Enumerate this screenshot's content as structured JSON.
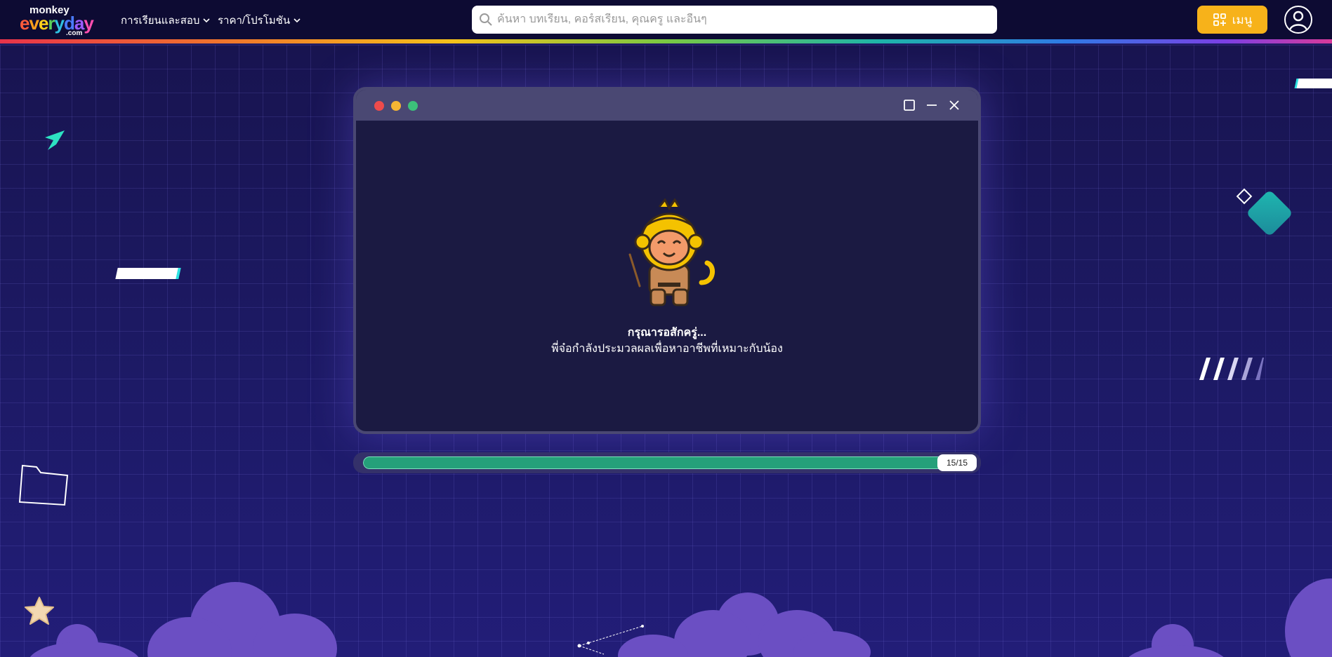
{
  "header": {
    "logo": {
      "top": "monkey",
      "main": "everyday",
      "suffix": ".com"
    },
    "nav": [
      {
        "label": "การเรียนและสอบ"
      },
      {
        "label": "ราคา/โปรโมชัน"
      }
    ],
    "search_placeholder": "ค้นหา บทเรียน, คอร์สเรียน, คุณครู และอื่นๆ",
    "menu_label": "เมนู"
  },
  "loading": {
    "title": "กรุณารอสักครู่...",
    "subtitle": "พี่จ๋อกำลังประมวลผลเพื่อหาอาชีพที่เหมาะกับน้อง"
  },
  "progress": {
    "current": 15,
    "total": 15,
    "label": "15/15"
  },
  "colors": {
    "nav_bg": "#0d0b33",
    "accent": "#f7b21a",
    "progress": "#25a07a",
    "window_bg": "#1b1a42"
  }
}
